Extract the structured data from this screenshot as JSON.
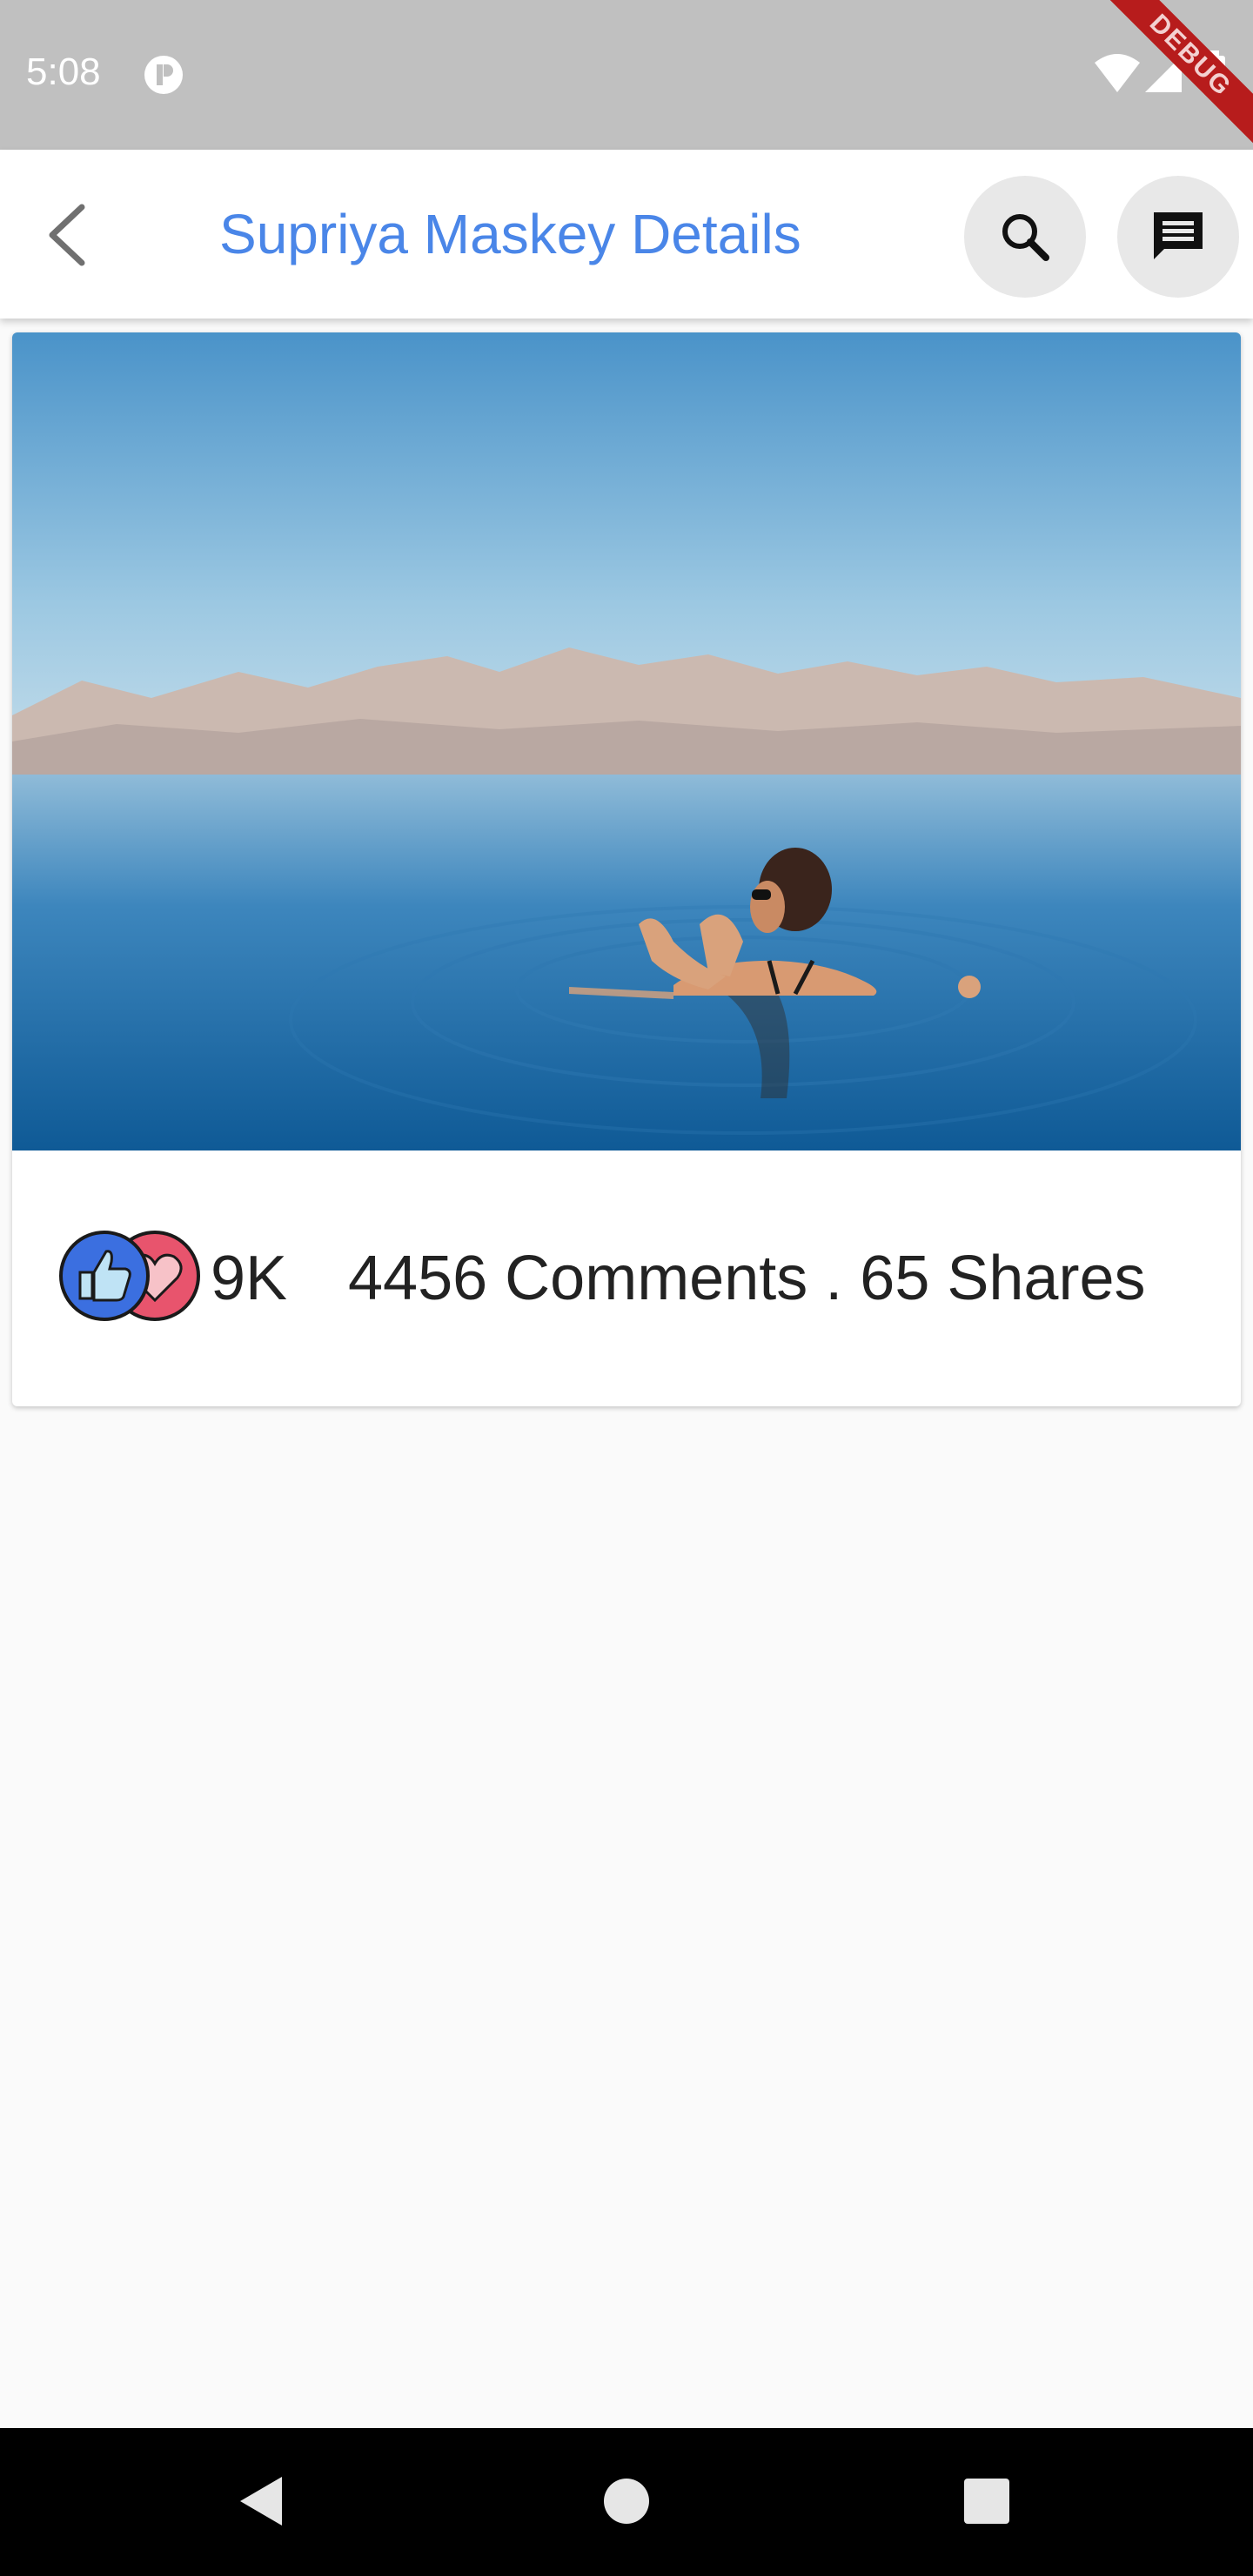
{
  "status_bar": {
    "time": "5:08",
    "debug_label": "DEBUG"
  },
  "app_bar": {
    "title": "Supriya Maskey Details",
    "title_color": "#4a86e8",
    "back_icon": "chevron-left-icon",
    "search_icon": "search-icon",
    "message_icon": "message-icon"
  },
  "post": {
    "image_description_icon": "photo",
    "reaction_count": "9K",
    "engagement": "4456 Comments . 65 Shares",
    "like_color": "#3b6fe0",
    "love_color": "#e8546d"
  },
  "nav_bar": {
    "back": "nav-back-icon",
    "home": "nav-home-icon",
    "recents": "nav-recents-icon"
  }
}
